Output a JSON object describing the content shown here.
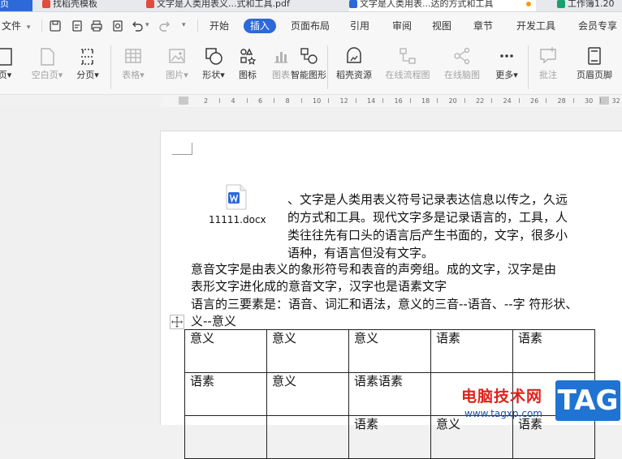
{
  "tabs": [
    {
      "label": "页",
      "color": "#e9b24b"
    },
    {
      "label": "找稻壳模板",
      "color": "#e24a3b"
    },
    {
      "label": "文字是人类用表义...式和工具.pdf",
      "color": "#e24a3b"
    },
    {
      "label": "文字是人类用表...达的方式和工具",
      "color": "#2c69d9"
    },
    {
      "label": "工作簿1.20",
      "color": "#1aa06d"
    }
  ],
  "menubar": {
    "file": "文件",
    "items": [
      "开始",
      "插入",
      "页面布局",
      "引用",
      "审阅",
      "视图",
      "章节",
      "开发工具",
      "会员专享"
    ],
    "active": "插入"
  },
  "toolbar": {
    "tools": [
      {
        "label": "页▾",
        "icon": "page-icon",
        "enabled": true
      },
      {
        "label": "空白页▾",
        "icon": "blank-page-icon",
        "enabled": false
      },
      {
        "label": "分页▾",
        "icon": "page-break-icon",
        "enabled": true
      },
      {
        "label": "表格▾",
        "icon": "table-icon",
        "enabled": false
      },
      {
        "label": "图片▾",
        "icon": "picture-icon",
        "enabled": false
      },
      {
        "label": "形状▾",
        "icon": "shape-icon",
        "enabled": true
      },
      {
        "label": "图标",
        "icon": "icon-library-icon",
        "enabled": true
      },
      {
        "label": "图表",
        "icon": "chart-icon",
        "enabled": false
      },
      {
        "label": "智能图形",
        "icon": "smart-art-icon",
        "enabled": true
      },
      {
        "label": "稻壳资源",
        "icon": "docer-resource-icon",
        "enabled": true
      },
      {
        "label": "在线流程图",
        "icon": "flowchart-icon",
        "enabled": false
      },
      {
        "label": "在线脑图",
        "icon": "mindmap-icon",
        "enabled": false
      },
      {
        "label": "更多▾",
        "icon": "more-icon",
        "enabled": true
      },
      {
        "label": "批注",
        "icon": "comment-icon",
        "enabled": false
      },
      {
        "label": "页眉页脚",
        "icon": "header-footer-icon",
        "enabled": true
      }
    ]
  },
  "ruler": {
    "ticks": [
      "2",
      "4",
      "6",
      "8",
      "10",
      "12",
      "14",
      "16",
      "18",
      "20",
      "22",
      "24",
      "26",
      "28",
      "30",
      "32"
    ]
  },
  "document": {
    "attachment_name": "11111.docx",
    "para1": [
      "、文字是人类用表义符号记录表达信息以传之，久远",
      "的方式和工具。现代文字多是记录语言的，工具，人",
      "类往往先有口头的语言后产生书面的，文字，很多小",
      "语种，有语言但没有文字。"
    ],
    "para2": [
      "意音文字是由表义的象形符号和表音的声旁组。成的文字，汉字是由",
      "表形文字进化成的意音文字，汉字也是语素文字"
    ],
    "para3": [
      "语言的三要素是：语音、词汇和语法，意义的三音--语音、--字  符形状、",
      "义--意义"
    ],
    "table": [
      [
        "意义",
        "意义",
        "意义",
        "语素",
        "语素"
      ],
      [
        "语素",
        "意义",
        "语素语素",
        "",
        ""
      ],
      [
        "",
        "",
        "语素",
        "意义",
        "语素"
      ]
    ]
  },
  "watermark": {
    "site_name": "电脑技术网",
    "url": "www.tagxp.com",
    "tag": "TAG"
  }
}
